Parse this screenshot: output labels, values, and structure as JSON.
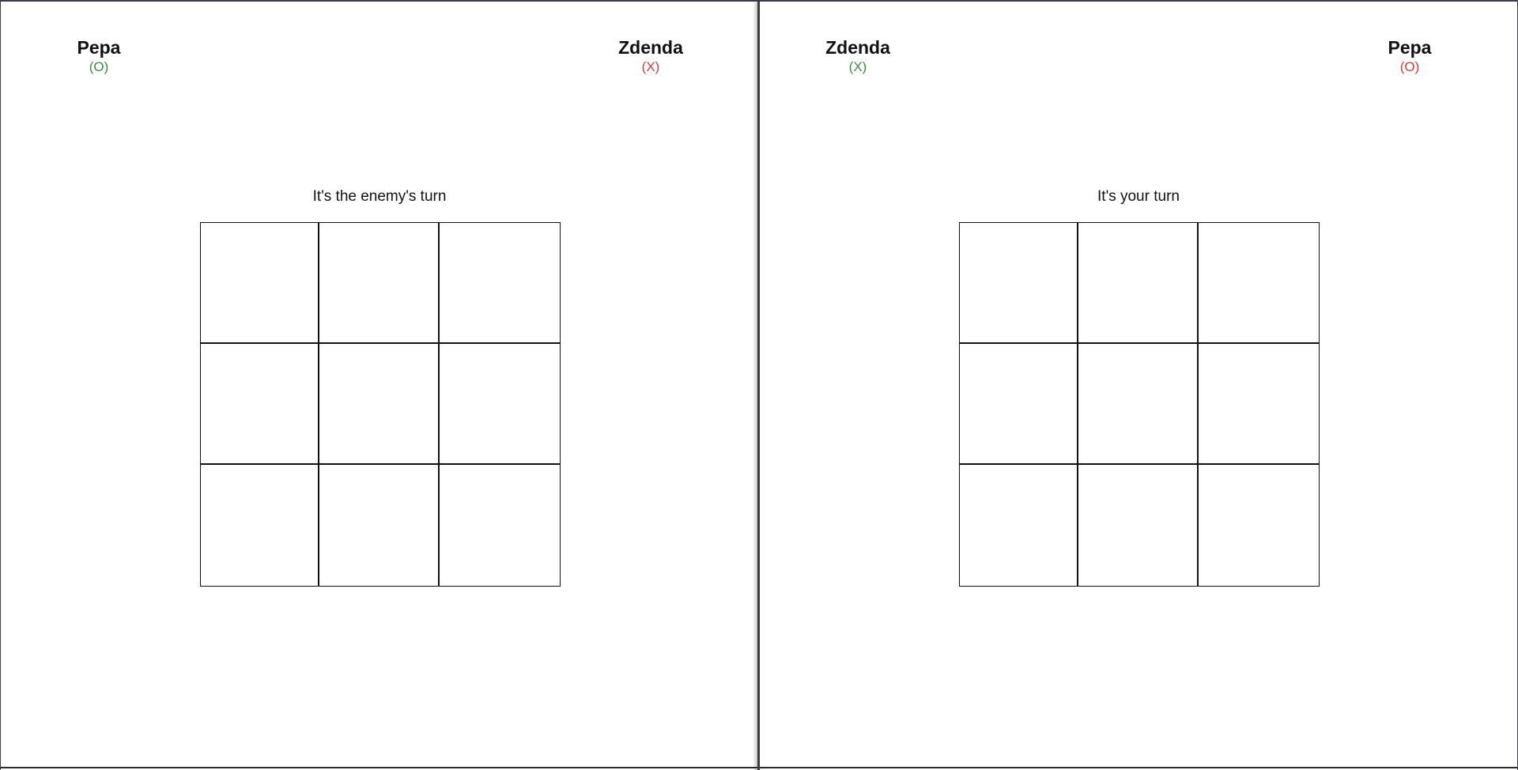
{
  "panels": [
    {
      "players": [
        {
          "name": "Pepa",
          "symbol": "(O)",
          "symbol_color": "#3c8a3c"
        },
        {
          "name": "Zdenda",
          "symbol": "(X)",
          "symbol_color": "#d23a3a"
        }
      ],
      "status": "It's the enemy's turn",
      "board": [
        "",
        "",
        "",
        "",
        "",
        "",
        "",
        "",
        ""
      ]
    },
    {
      "players": [
        {
          "name": "Zdenda",
          "symbol": "(X)",
          "symbol_color": "#3c8a3c"
        },
        {
          "name": "Pepa",
          "symbol": "(O)",
          "symbol_color": "#d23a3a"
        }
      ],
      "status": "It's your turn",
      "board": [
        "",
        "",
        "",
        "",
        "",
        "",
        "",
        "",
        ""
      ]
    }
  ]
}
